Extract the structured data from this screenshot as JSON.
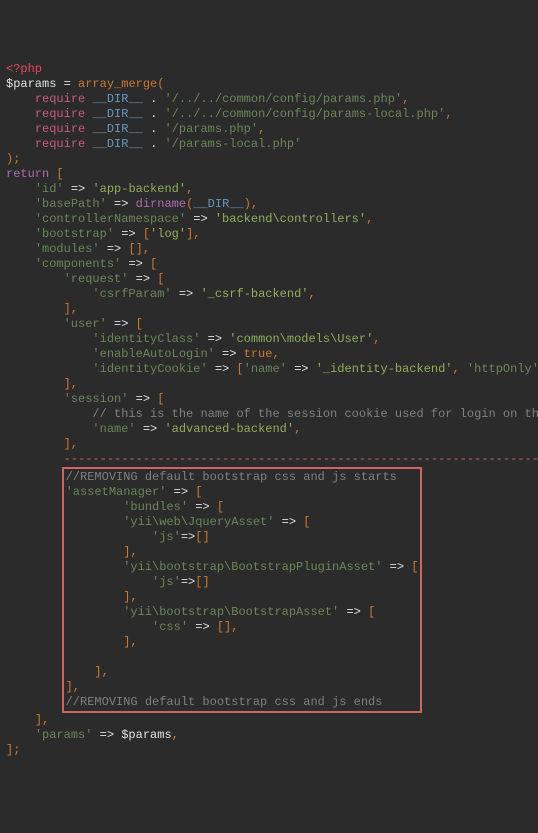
{
  "php_open": "<?php",
  "l1": {
    "var": "$params",
    "eq": "=",
    "fn": "array_merge",
    "open": "("
  },
  "req1": {
    "kw": "require",
    "dir": "__DIR__",
    "dot": ".",
    "str": "'/../../common/config/params.php'",
    "c": ","
  },
  "req2": {
    "kw": "require",
    "dir": "__DIR__",
    "dot": ".",
    "str": "'/../../common/config/params-local.php'",
    "c": ","
  },
  "req3": {
    "kw": "require",
    "dir": "__DIR__",
    "dot": ".",
    "str": "'/params.php'",
    "c": ","
  },
  "req4": {
    "kw": "require",
    "dir": "__DIR__",
    "dot": ".",
    "str": "'/params-local.php'"
  },
  "close_paren": ");",
  "ret": {
    "kw": "return",
    "open": "["
  },
  "id": {
    "k": "'id'",
    "a": "=>",
    "v": "'app-backend'",
    "c": ","
  },
  "bp": {
    "k": "'basePath'",
    "a": "=>",
    "fn": "dirname",
    "p1": "(",
    "d": "__DIR__",
    "p2": ")",
    "c": ","
  },
  "cn": {
    "k": "'controllerNamespace'",
    "a": "=>",
    "v": "'backend\\controllers'",
    "c": ","
  },
  "bs": {
    "k": "'bootstrap'",
    "a": "=>",
    "open": "[",
    "v": "'log'",
    "close": "]",
    "c": ","
  },
  "mod": {
    "k": "'modules'",
    "a": "=>",
    "open": "[",
    "close": "]",
    "c": ","
  },
  "comp": {
    "k": "'components'",
    "a": "=>",
    "open": "["
  },
  "reqc": {
    "k": "'request'",
    "a": "=>",
    "open": "["
  },
  "csrf": {
    "k": "'csrfParam'",
    "a": "=>",
    "v": "'_csrf-backend'",
    "c": ","
  },
  "close1": "],",
  "user": {
    "k": "'user'",
    "a": "=>",
    "open": "["
  },
  "idc": {
    "k": "'identityClass'",
    "a": "=>",
    "v": "'common\\models\\User'",
    "c": ","
  },
  "eal": {
    "k": "'enableAutoLogin'",
    "a": "=>",
    "v": "true",
    "c": ","
  },
  "idck": {
    "k": "'identityCookie'",
    "a": "=>",
    "open": "[",
    "k2": "'name'",
    "a2": "=>",
    "v2": "'_identity-backend'",
    "c2": ",",
    "k3": "'httpOnly'",
    "a3": "=>",
    "v3": "true",
    "close": "]",
    "c": ","
  },
  "close2": "],",
  "sess": {
    "k": "'session'",
    "a": "=>",
    "open": "["
  },
  "comm1": "// this is the name of the session cookie used for login on the backend",
  "sname": {
    "k": "'name'",
    "a": "=>",
    "v": "'advanced-backend'",
    "c": ","
  },
  "close3": "],",
  "dashes": "------------------------------------------------------------------------",
  "box": {
    "c1": "//REMOVING default bootstrap css and js starts",
    "am": {
      "k": "'assetManager'",
      "a": "=>",
      "open": "["
    },
    "bun": {
      "k": "'bundles'",
      "a": "=>",
      "open": "["
    },
    "jq": {
      "k": "'yii\\web\\JqueryAsset'",
      "a": "=>",
      "open": "["
    },
    "jqjs": {
      "k": "'js'",
      "a": "=>",
      "open": "[",
      "close": "]"
    },
    "closejq": "],",
    "bpa": {
      "k": "'yii\\bootstrap\\BootstrapPluginAsset'",
      "a": "=>",
      "open": "["
    },
    "bpajs": {
      "k": "'js'",
      "a": "=>",
      "open": "[",
      "close": "]"
    },
    "closebpa": "],",
    "bsa": {
      "k": "'yii\\bootstrap\\BootstrapAsset'",
      "a": "=>",
      "open": "["
    },
    "bsacss": {
      "k": "'css'",
      "a": "=>",
      "open": "[",
      "close": "]",
      "c": ","
    },
    "closebsa": "],",
    "closein": "],",
    "closeam": "],",
    "c2": "//REMOVING default bootstrap css and js ends"
  },
  "closecomp": "],",
  "paramsline": {
    "k": "'params'",
    "a": "=>",
    "v": "$params",
    "c": ","
  },
  "closeall": "];"
}
